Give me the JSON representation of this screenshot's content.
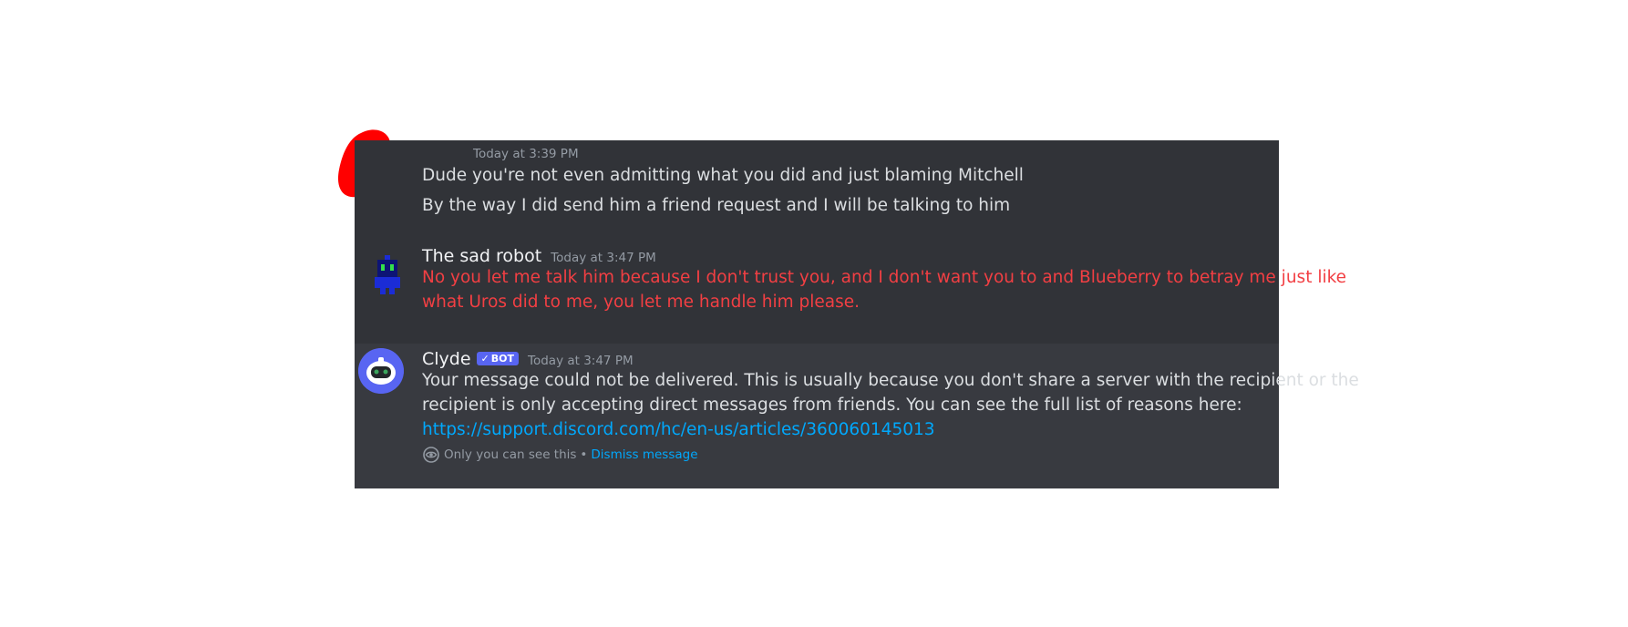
{
  "messages": [
    {
      "timestamp": "Today at 3:39 PM",
      "lines": [
        "Dude you're not even admitting what you did and just blaming Mitchell",
        "By the way I did send him a friend request and I will be talking to him"
      ]
    },
    {
      "username": "The sad robot",
      "timestamp": "Today at 3:47 PM",
      "lines": [
        "No you let me talk him because I don't trust you, and I don't want you to and Blueberry to betray me just like",
        "what Uros did to me, you let me handle him please."
      ],
      "text_color": "#f23f43"
    },
    {
      "username": "Clyde",
      "bot_tag": "BOT",
      "timestamp": "Today at 3:47 PM",
      "lines": [
        "Your message could not be delivered. This is usually because you don't share a server with the recipient or the",
        "recipient is only accepting direct messages from friends. You can see the full list of reasons here:"
      ],
      "link": "https://support.discord.com/hc/en-us/articles/360060145013",
      "ephemeral_note": "Only you can see this",
      "separator": "•",
      "dismiss_label": "Dismiss message"
    }
  ],
  "colors": {
    "background": "#313338",
    "clyde_background": "#383a40",
    "text": "#dbdee1",
    "error_text": "#f23f43",
    "link": "#00a8fc",
    "bot_tag": "#5865f2",
    "redaction": "#ff0000"
  }
}
